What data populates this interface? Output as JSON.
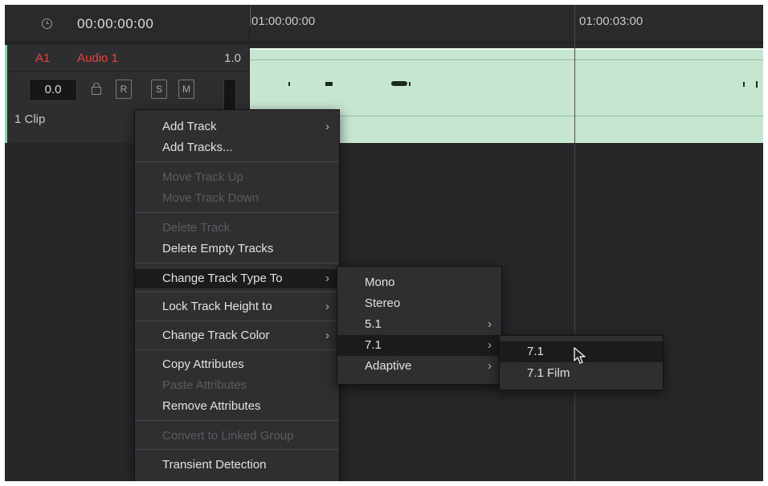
{
  "header": {
    "timecode": "00:00:00:00",
    "ruler_labels": [
      "01:00:00:00",
      "01:00:03:00"
    ]
  },
  "track": {
    "id": "A1",
    "name": "Audio 1",
    "type_value": "1.0",
    "volume": "0.0",
    "buttons": {
      "record": "R",
      "solo": "S",
      "mute": "M"
    },
    "clip_count": "1 Clip"
  },
  "context_menu": {
    "items": [
      {
        "label": "Add Track"
      },
      {
        "label": "Add Tracks..."
      },
      {
        "label": "Move Track Up"
      },
      {
        "label": "Move Track Down"
      },
      {
        "label": "Delete Track"
      },
      {
        "label": "Delete Empty Tracks"
      },
      {
        "label": "Change Track Type To"
      },
      {
        "label": "Lock Track Height to"
      },
      {
        "label": "Change Track Color"
      },
      {
        "label": "Copy Attributes"
      },
      {
        "label": "Paste Attributes"
      },
      {
        "label": "Remove Attributes"
      },
      {
        "label": "Convert to Linked Group"
      },
      {
        "label": "Transient Detection"
      }
    ]
  },
  "track_type_submenu": {
    "items": [
      {
        "label": "Mono"
      },
      {
        "label": "Stereo"
      },
      {
        "label": "5.1"
      },
      {
        "label": "7.1"
      },
      {
        "label": "Adaptive"
      }
    ]
  },
  "seven_one_submenu": {
    "items": [
      {
        "label": "7.1"
      },
      {
        "label": "7.1 Film"
      }
    ]
  },
  "icons": {
    "clock": "clock-icon",
    "lock": "lock-icon",
    "submenu": "chevron-right-icon",
    "cursor": "mouse-pointer-icon"
  },
  "colors": {
    "track_label": "#e0483f",
    "clip_fill": "#c7e6d1",
    "menu_bg": "#2f2f31",
    "menu_highlight": "#1b1b1d"
  }
}
